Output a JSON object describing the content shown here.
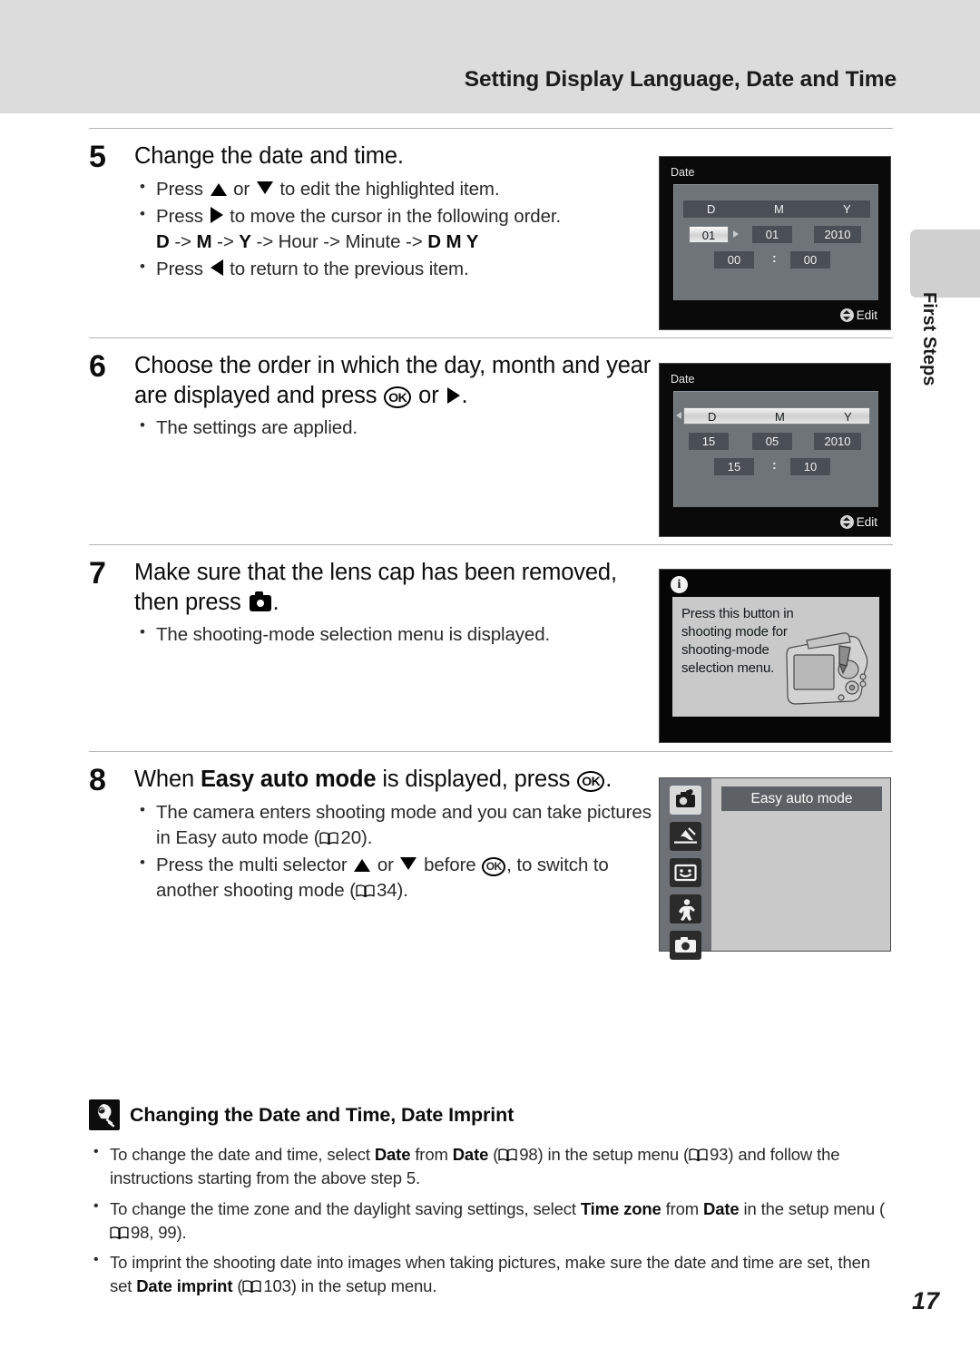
{
  "header": {
    "title": "Setting Display Language, Date and Time"
  },
  "side_tab": {
    "label": "First Steps"
  },
  "steps": [
    {
      "number": "5",
      "title": "Change the date and time.",
      "bullets": [
        "Press ▲ or ▼ to edit the highlighted item.",
        "Press ▶ to move the cursor in the following order.",
        "Press ◀ to return to the previous item."
      ],
      "order_sequence": "D -> M -> Y -> Hour -> Minute -> D M Y"
    },
    {
      "number": "6",
      "title": "Choose the order in which the day, month and year are displayed and press OK or ▶.",
      "bullets": [
        "The settings are applied."
      ]
    },
    {
      "number": "7",
      "title": "Make sure that the lens cap has been removed, then press camera-button.",
      "bullets": [
        "The shooting-mode selection menu is displayed."
      ]
    },
    {
      "number": "8",
      "title": "When Easy auto mode is displayed, press OK.",
      "title_bold_part": "Easy auto mode",
      "bullets": [
        "The camera enters shooting mode and you can take pictures in Easy auto mode (20).",
        "Press the multi selector ▲ or ▼ before OK, to switch to another shooting mode (34)."
      ],
      "page_refs": [
        "20",
        "34"
      ]
    }
  ],
  "screens": {
    "date_screen_1": {
      "title": "Date",
      "columns": [
        "D",
        "M",
        "Y"
      ],
      "day": "01",
      "month": "01",
      "year": "2010",
      "hour": "00",
      "minute": "00",
      "separator": ":",
      "footer_label": "Edit",
      "highlighted_field": "day"
    },
    "date_screen_2": {
      "title": "Date",
      "columns": [
        "D",
        "M",
        "Y"
      ],
      "day": "15",
      "month": "05",
      "year": "2010",
      "hour": "15",
      "minute": "10",
      "separator": ":",
      "footer_label": "Edit",
      "highlighted_field": "dmy-order-bar"
    },
    "info_screen": {
      "icon": "info-icon",
      "text": "Press this button in shooting mode for shooting-mode selection menu."
    },
    "mode_screen": {
      "selected_label": "Easy auto mode",
      "icons": [
        "easy-auto-mode-icon",
        "scene-mode-icon",
        "smart-portrait-icon",
        "subject-tracking-icon",
        "auto-mode-icon"
      ]
    }
  },
  "note": {
    "icon": "lightbulb-icon",
    "title": "Changing the Date and Time, Date Imprint",
    "bullets": [
      {
        "prefix": "To change the date and time, select ",
        "b1": "Date",
        "mid1": " from ",
        "b2": "Date",
        "ref1": "98",
        "mid2": ") in the setup menu (",
        "ref2": "93",
        "suffix": ") and follow the instructions starting from the above step 5."
      },
      {
        "prefix": "To change the time zone and the daylight saving settings, select ",
        "b1": "Time zone",
        "mid1": " from ",
        "b2": "Date",
        "mid2": " in the setup menu (",
        "ref1": "98, 99",
        "suffix": ")."
      },
      {
        "prefix": "To imprint the shooting date into images when taking pictures, make sure the date and time are set, then set ",
        "b1": "Date imprint",
        "ref1": "103",
        "suffix": ") in the setup menu."
      }
    ]
  },
  "page_number": "17",
  "colors": {
    "header_band": "#dcdcdc",
    "side_tab": "#d0d0d0",
    "screen_frame": "#0a0a0a",
    "screen_panel": "#6f7479",
    "field": "#4a4f55"
  }
}
